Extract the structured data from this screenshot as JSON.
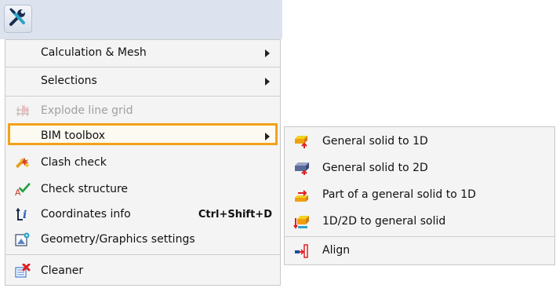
{
  "toolbar": {
    "tools_icon": "tools-icon"
  },
  "menu": {
    "items": [
      {
        "label": "Calculation & Mesh",
        "has_submenu": true
      },
      {
        "label": "Selections",
        "has_submenu": true
      },
      {
        "label": "Explode line grid",
        "disabled": true,
        "icon": "explode-grid-icon"
      },
      {
        "label": "BIM toolbox",
        "has_submenu": true,
        "highlighted": true
      },
      {
        "label": "Clash check",
        "icon": "clash-check-icon"
      },
      {
        "label": "Check structure",
        "icon": "check-structure-icon"
      },
      {
        "label": "Coordinates info",
        "icon": "coordinates-icon",
        "shortcut": "Ctrl+Shift+D"
      },
      {
        "label": "Geometry/Graphics settings",
        "icon": "geometry-settings-icon"
      },
      {
        "label": "Cleaner",
        "icon": "cleaner-icon"
      }
    ]
  },
  "submenu": {
    "items": [
      {
        "label": "General solid to 1D",
        "icon": "solid-to-1d-icon"
      },
      {
        "label": "General solid to 2D",
        "icon": "solid-to-2d-icon"
      },
      {
        "label": "Part of a general solid to 1D",
        "icon": "part-solid-to-1d-icon"
      },
      {
        "label": "1D/2D to general solid",
        "icon": "1d2d-to-solid-icon"
      },
      {
        "label": "Align",
        "icon": "align-icon"
      }
    ]
  },
  "colors": {
    "highlight_border": "#f3a21a",
    "menu_background": "#f4f4f4",
    "toolbar_background": "#dde3ee",
    "disabled_text": "#a0a0a0"
  }
}
